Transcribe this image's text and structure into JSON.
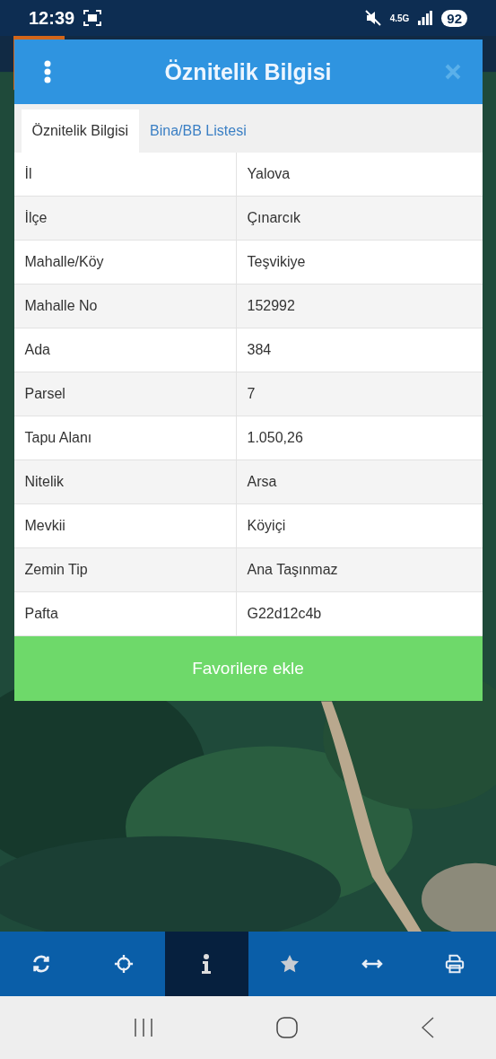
{
  "status_bar": {
    "time": "12:39",
    "network": "4.5G",
    "battery": "92"
  },
  "dialog": {
    "title": "Öznitelik Bilgisi",
    "tabs": [
      {
        "label": "Öznitelik Bilgisi",
        "selected": true
      },
      {
        "label": "Bina/BB Listesi",
        "selected": false
      }
    ],
    "rows": [
      {
        "label": "İl",
        "value": "Yalova"
      },
      {
        "label": "İlçe",
        "value": "Çınarcık"
      },
      {
        "label": "Mahalle/Köy",
        "value": "Teşvikiye"
      },
      {
        "label": "Mahalle No",
        "value": "152992"
      },
      {
        "label": "Ada",
        "value": "384"
      },
      {
        "label": "Parsel",
        "value": "7"
      },
      {
        "label": "Tapu Alanı",
        "value": "1.050,26"
      },
      {
        "label": "Nitelik",
        "value": "Arsa"
      },
      {
        "label": "Mevkii",
        "value": "Köyiçi"
      },
      {
        "label": "Zemin Tip",
        "value": "Ana Taşınmaz"
      },
      {
        "label": "Pafta",
        "value": "G22d12c4b"
      }
    ],
    "button": "Favorilere ekle"
  },
  "toolbar": [
    {
      "kind": "refresh",
      "selected": false
    },
    {
      "kind": "locate",
      "selected": false
    },
    {
      "kind": "info",
      "selected": true
    },
    {
      "kind": "favorite",
      "selected": false
    },
    {
      "kind": "measure",
      "selected": false
    },
    {
      "kind": "print",
      "selected": false
    }
  ]
}
